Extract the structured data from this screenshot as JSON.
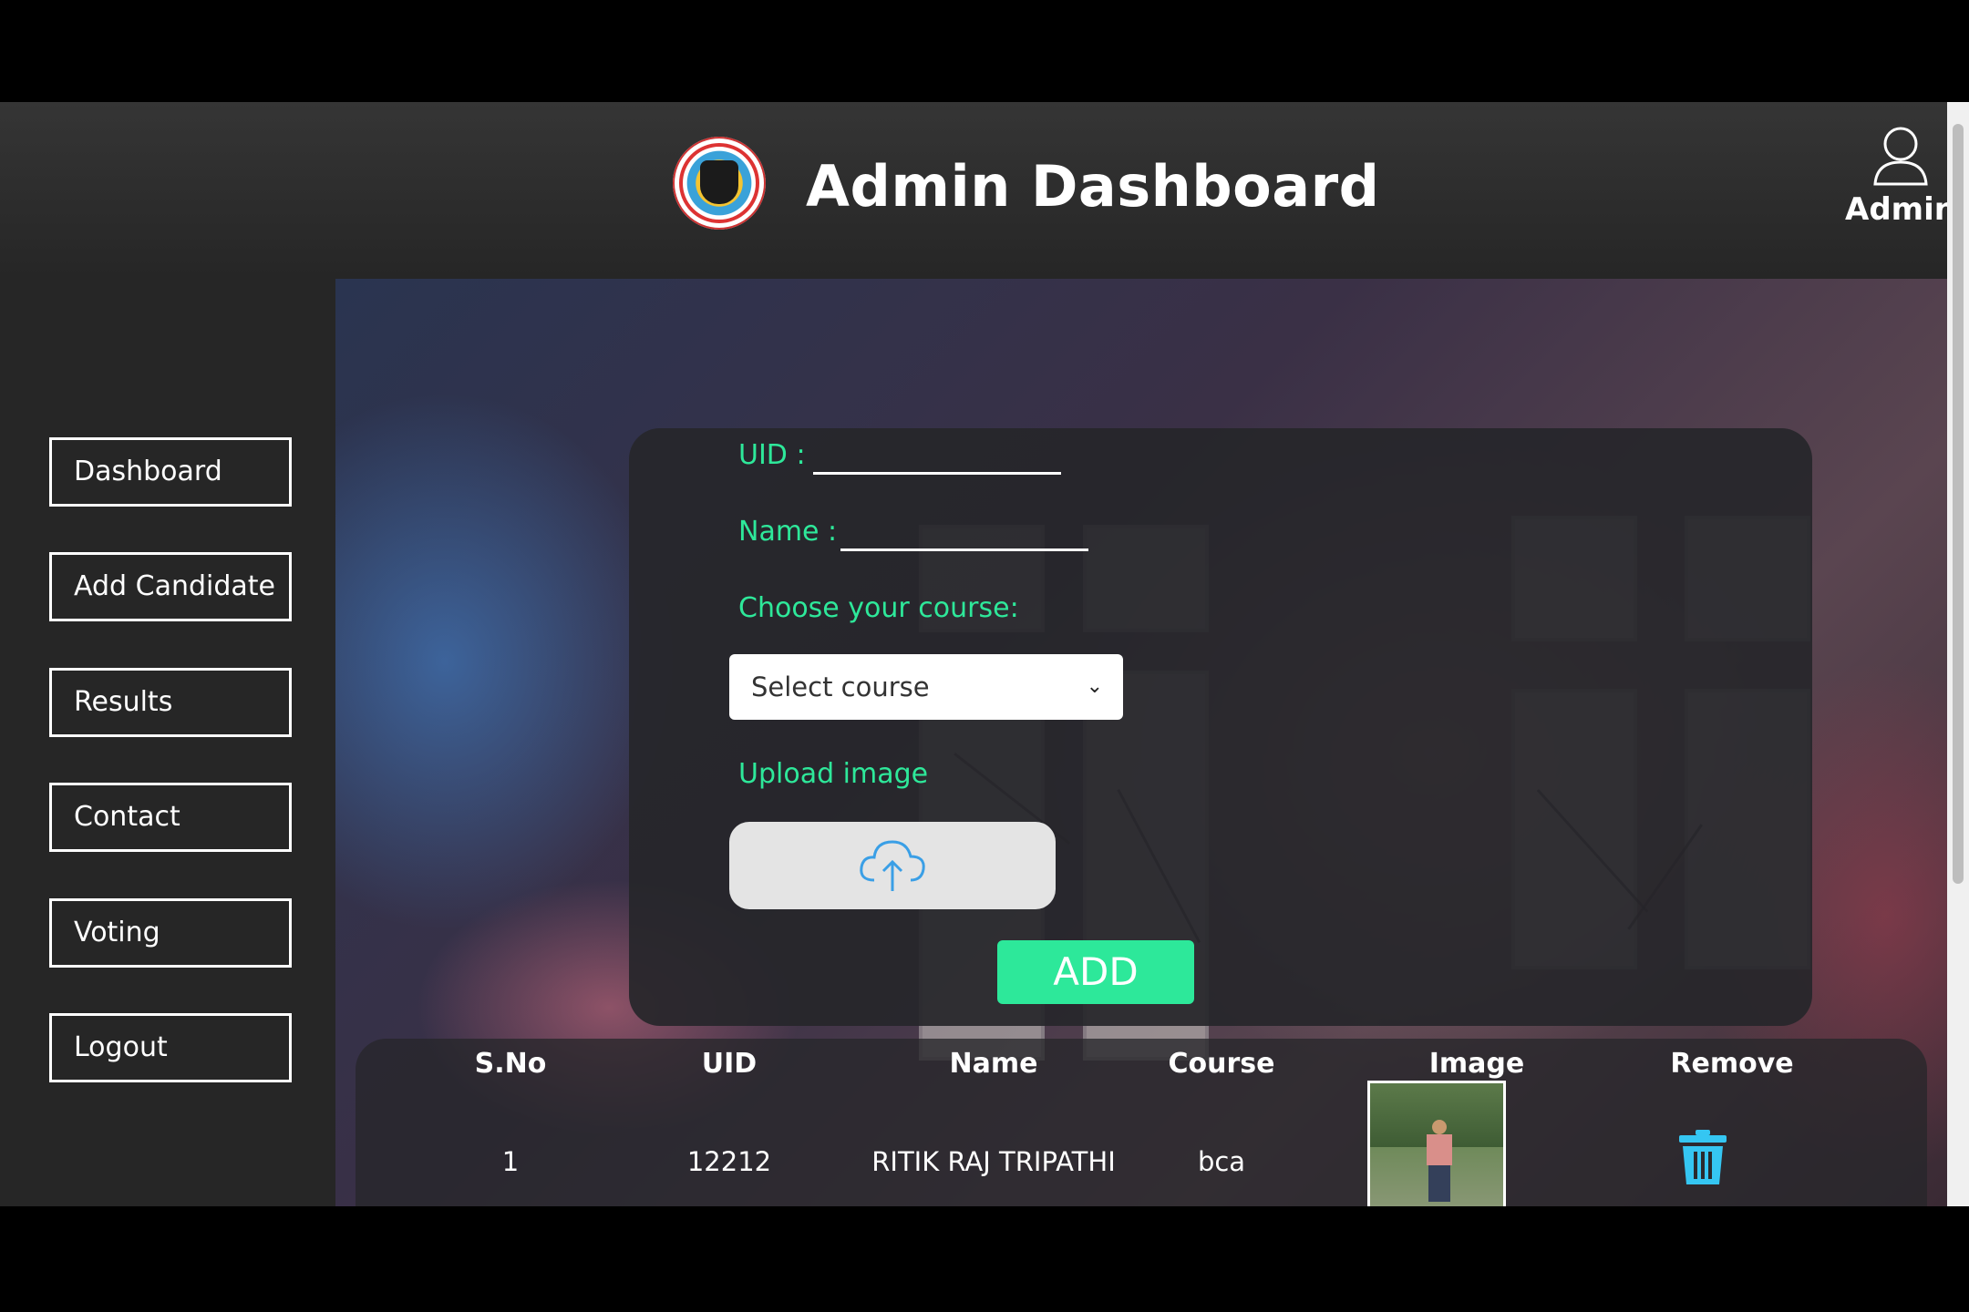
{
  "header": {
    "title": "Admin Dashboard",
    "user_label": "Admin"
  },
  "sidebar": {
    "items": [
      {
        "label": "Dashboard"
      },
      {
        "label": "Add Candidate"
      },
      {
        "label": "Results"
      },
      {
        "label": "Contact"
      },
      {
        "label": "Voting"
      },
      {
        "label": "Logout"
      }
    ]
  },
  "form": {
    "uid_label": "UID :",
    "name_label": "Name :",
    "course_label": "Choose your course:",
    "course_select_value": "Select course",
    "upload_label": "Upload image",
    "add_label": "ADD",
    "accent_color": "#2ee89a"
  },
  "table": {
    "headers": [
      "S.No",
      "UID",
      "Name",
      "Course",
      "Image",
      "Remove"
    ],
    "rows": [
      {
        "sno": "1",
        "uid": "12212",
        "name": "RITIK RAJ TRIPATHI",
        "course": "bca"
      }
    ]
  },
  "icons": [
    "user-icon",
    "cloud-upload-icon",
    "trash-icon",
    "chevron-down-icon"
  ]
}
